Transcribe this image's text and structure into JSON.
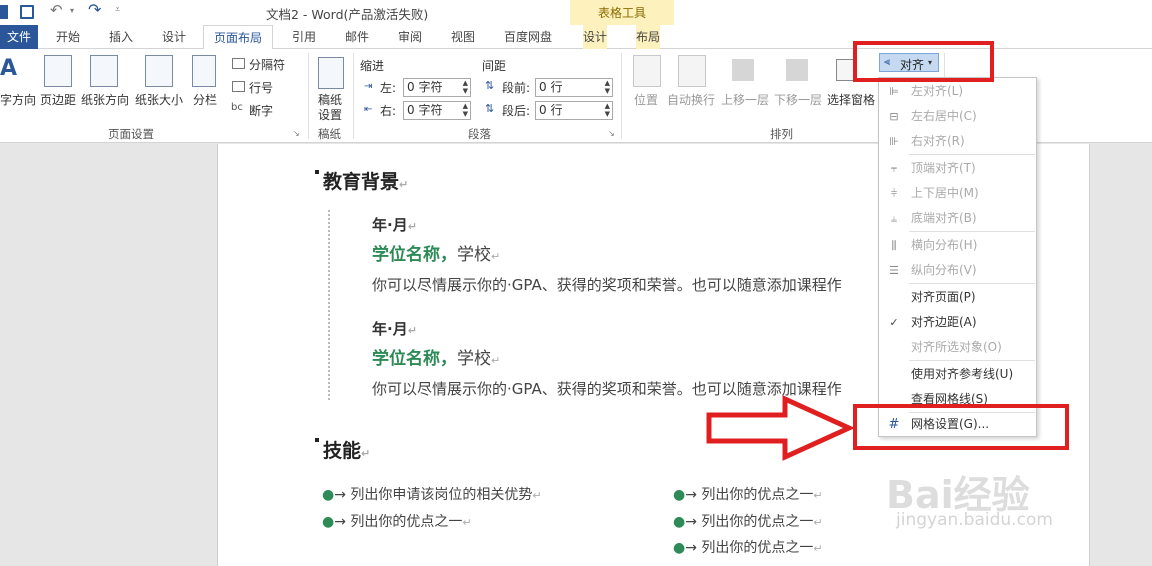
{
  "titlebar": {
    "title": "文档2 - Word(产品激活失败)",
    "table_tools": "表格工具"
  },
  "tabs": [
    "文件",
    "开始",
    "插入",
    "设计",
    "页面布局",
    "引用",
    "邮件",
    "审阅",
    "视图",
    "百度网盘",
    "设计",
    "布局"
  ],
  "ribbon": {
    "page_setup": {
      "text_direction": "字方向",
      "margins": "页边距",
      "orientation": "纸张方向",
      "size": "纸张大小",
      "columns": "分栏",
      "breaks": "分隔符",
      "line_numbers": "行号",
      "hyphenation": "断字",
      "group": "页面设置"
    },
    "paper": {
      "button1": "稿纸",
      "button2": "设置",
      "group": "稿纸"
    },
    "paragraph": {
      "indent_label": "缩进",
      "spacing_label": "间距",
      "left_label": "左:",
      "right_label": "右:",
      "left_value": "0 字符",
      "right_value": "0 字符",
      "before_label": "段前:",
      "after_label": "段后:",
      "before_value": "0 行",
      "after_value": "0 行",
      "group": "段落"
    },
    "arrange": {
      "position": "位置",
      "wrap": "自动换行",
      "forward": "上移一层",
      "backward": "下移一层",
      "selection_pane": "选择窗格",
      "align": "对齐",
      "group": "排列"
    }
  },
  "document": {
    "section1_title": "教育背景",
    "entry1": {
      "year": "年·月",
      "degree": "学位名称，",
      "school": "学校",
      "desc": "你可以尽情展示你的·GPA、获得的奖项和荣誉。也可以随意添加课程作"
    },
    "entry2": {
      "year": "年·月",
      "degree": "学位名称，",
      "school": "学校",
      "desc": "你可以尽情展示你的·GPA、获得的奖项和荣誉。也可以随意添加课程作"
    },
    "section2_title": "技能",
    "bullets_left": [
      "列出你申请该岗位的相关优势",
      "列出你的优点之一"
    ],
    "bullets_right": [
      "列出你的优点之一",
      "列出你的优点之一",
      "列出你的优点之一"
    ]
  },
  "align_menu": {
    "items": [
      {
        "label": "左对齐(L)",
        "disabled": true,
        "icon": "align-left-icon"
      },
      {
        "label": "左右居中(C)",
        "disabled": true,
        "icon": "align-center-icon"
      },
      {
        "label": "右对齐(R)",
        "disabled": true,
        "icon": "align-right-icon"
      },
      {
        "label": "顶端对齐(T)",
        "disabled": true,
        "icon": "align-top-icon"
      },
      {
        "label": "上下居中(M)",
        "disabled": true,
        "icon": "align-middle-icon"
      },
      {
        "label": "底端对齐(B)",
        "disabled": true,
        "icon": "align-bottom-icon"
      },
      {
        "label": "横向分布(H)",
        "disabled": true,
        "icon": "distribute-horizontal-icon"
      },
      {
        "label": "纵向分布(V)",
        "disabled": true,
        "icon": "distribute-vertical-icon"
      },
      {
        "label": "对齐页面(P)",
        "disabled": false,
        "icon": ""
      },
      {
        "label": "对齐边距(A)",
        "disabled": false,
        "icon": "checkmark-icon"
      },
      {
        "label": "对齐所选对象(O)",
        "disabled": true,
        "icon": ""
      },
      {
        "label": "使用对齐参考线(U)",
        "disabled": false,
        "icon": ""
      },
      {
        "label": "查看网格线(S)",
        "disabled": false,
        "icon": ""
      },
      {
        "label": "网格设置(G)...",
        "disabled": false,
        "icon": "grid-icon"
      }
    ]
  },
  "watermark": {
    "text": "Bai经验",
    "url": "jingyan.baidu.com"
  },
  "colors": {
    "accent": "#2b579a",
    "degree_green": "#2e8b57",
    "highlight_red": "#e02020",
    "table_tools": "#fdf2bd"
  }
}
